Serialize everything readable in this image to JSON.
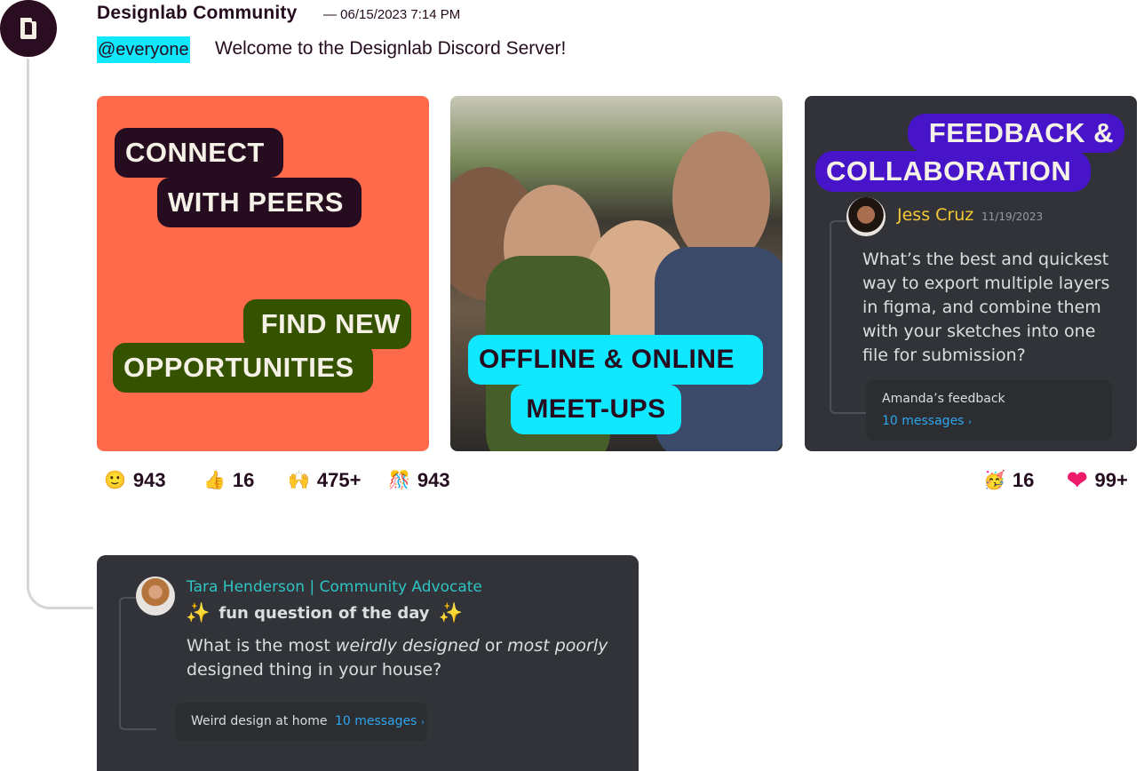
{
  "message": {
    "author": "Designlab Community",
    "timestamp": "— 06/15/2023 7:14 PM",
    "mention": "@everyone",
    "text": "Welcome to the Designlab Discord Server!"
  },
  "cards": {
    "connect": {
      "line1": "CONNECT",
      "line2": "WITH PEERS",
      "line3": "FIND NEW",
      "line4": "OPPORTUNITIES"
    },
    "meetups": {
      "line1": "OFFLINE & ONLINE",
      "line2": "MEET-UPS"
    },
    "feedback": {
      "line1": "FEEDBACK &",
      "line2": "COLLABORATION",
      "post": {
        "author": "Jess Cruz",
        "date": "11/19/2023",
        "text": "What’s the best and quickest way to export multiple layers in figma, and combine them with your sketches into one file for submission?",
        "thread_title": "Amanda’s feedback",
        "thread_link": "10 messages",
        "thread_chevron": "›"
      }
    }
  },
  "reactions": [
    {
      "icon": "slightly-smiling-face",
      "glyph": "🙂",
      "count": "943"
    },
    {
      "icon": "thumbs-up",
      "glyph": "👍",
      "count": "16"
    },
    {
      "icon": "raising-hands",
      "glyph": "🙌",
      "count": "475+"
    },
    {
      "icon": "confetti",
      "glyph": "🎊",
      "count": "943"
    },
    {
      "icon": "partying-face",
      "glyph": "🥳",
      "count": "16"
    },
    {
      "icon": "heart",
      "glyph": "❤",
      "count": "99+"
    }
  ],
  "reply": {
    "author": "Tara Henderson | Community Advocate",
    "sparkle": "✨",
    "title": "fun question of the day",
    "text_a": "What is the most ",
    "text_b": "weirdly designed",
    "text_c": " or ",
    "text_d": "most poorly",
    "text_e": "designed thing in your house?",
    "thread_title": "Weird design at home",
    "thread_link": "10 messages",
    "thread_chevron": "›"
  },
  "colors": {
    "brand_dark": "#260c1f",
    "mention_cyan": "#10e8ff",
    "coral": "#ff6b4a",
    "green": "#355200",
    "purple": "#4714c9",
    "discord_bg": "#313338",
    "link_blue": "#2fa7ee",
    "jess_yellow": "#f5c937",
    "tara_teal": "#2ec4c4"
  }
}
